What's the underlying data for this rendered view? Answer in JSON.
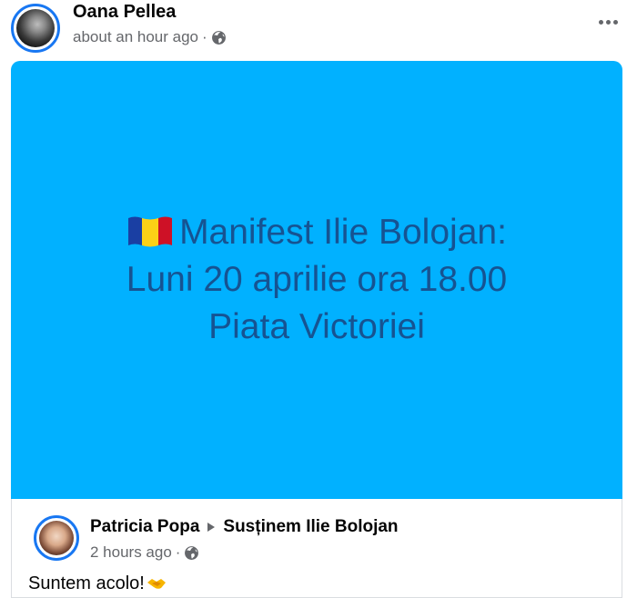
{
  "post": {
    "author": "Oana Pellea",
    "timestamp": "about an hour ago",
    "separator": "·",
    "privacy_icon": "globe-icon",
    "more_icon": "more-horizontal-icon",
    "image": {
      "background_color": "#01b1ff",
      "text_color": "#165392",
      "flag_icon": "romania-flag-icon",
      "lines": [
        "Manifest Ilie  Bolojan:",
        "Luni 20 aprilie ora 18.00",
        "Piata Victoriei"
      ]
    }
  },
  "shared": {
    "author": "Patricia Popa",
    "arrow_icon": "triangle-right-icon",
    "group": "Susținem Ilie Bolojan",
    "timestamp": "2 hours ago",
    "separator": "·",
    "privacy_icon": "globe-icon",
    "text": "Suntem acolo!",
    "emoji_icon": "handshake-icon"
  },
  "colors": {
    "accent": "#1877f2",
    "secondary_text": "#65676b"
  }
}
